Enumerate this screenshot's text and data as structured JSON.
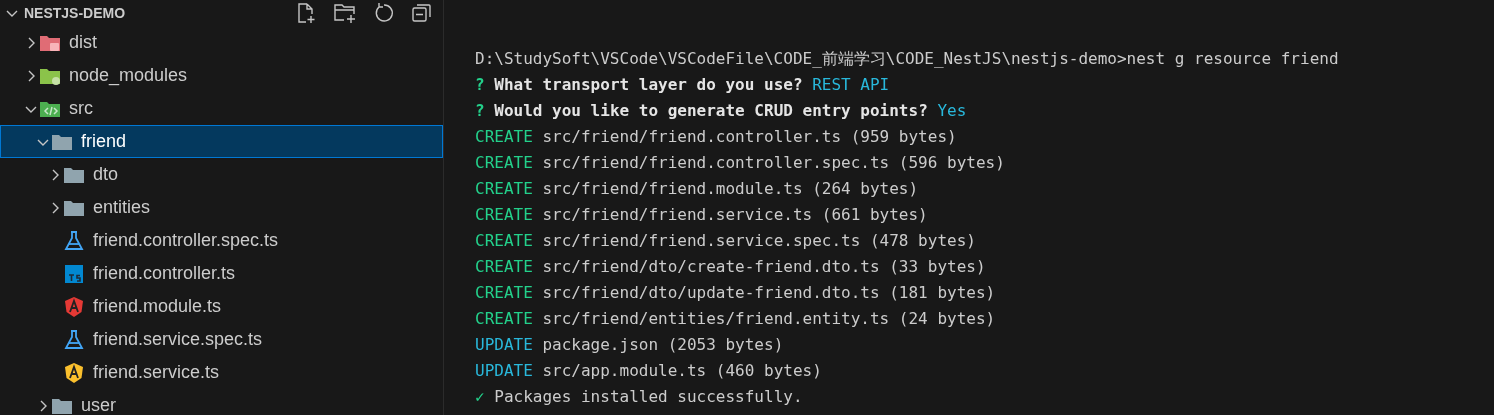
{
  "explorer": {
    "title": "NESTJS-DEMO",
    "expanded": true,
    "tree": [
      {
        "label": "dist",
        "kind": "dist",
        "expanded": false,
        "selected": false
      },
      {
        "label": "node_modules",
        "kind": "modules",
        "expanded": false,
        "selected": false
      },
      {
        "label": "src",
        "kind": "source",
        "expanded": true,
        "selected": false,
        "children": [
          {
            "label": "friend",
            "kind": "folder",
            "expanded": true,
            "selected": true,
            "children": [
              {
                "label": "dto",
                "kind": "folder",
                "expanded": false,
                "selected": false
              },
              {
                "label": "entities",
                "kind": "folder",
                "expanded": false,
                "selected": false
              },
              {
                "label": "friend.controller.spec.ts",
                "kind": "spec",
                "selected": false
              },
              {
                "label": "friend.controller.ts",
                "kind": "typescript",
                "selected": false
              },
              {
                "label": "friend.module.ts",
                "kind": "module",
                "selected": false
              },
              {
                "label": "friend.service.spec.ts",
                "kind": "spec",
                "selected": false
              },
              {
                "label": "friend.service.ts",
                "kind": "service",
                "selected": false
              }
            ]
          },
          {
            "label": "user",
            "kind": "folder",
            "expanded": false,
            "selected": false
          }
        ]
      }
    ]
  },
  "terminal": {
    "lines": [
      {
        "kind": "command",
        "text": "D:\\StudySoft\\VSCode\\VSCodeFile\\CODE_前端学习\\CODE_NestJS\\nestjs-demo>nest g resource friend"
      },
      {
        "kind": "prompt",
        "mark": "?",
        "question": "What transport layer do you use?",
        "answer": "REST API"
      },
      {
        "kind": "prompt",
        "mark": "?",
        "question": "Would you like to generate CRUD entry points?",
        "answer": "Yes"
      },
      {
        "kind": "action",
        "action": "CREATE",
        "color": "#23d18b",
        "text": "src/friend/friend.controller.ts (959 bytes)"
      },
      {
        "kind": "action",
        "action": "CREATE",
        "color": "#23d18b",
        "text": "src/friend/friend.controller.spec.ts (596 bytes)"
      },
      {
        "kind": "action",
        "action": "CREATE",
        "color": "#23d18b",
        "text": "src/friend/friend.module.ts (264 bytes)"
      },
      {
        "kind": "action",
        "action": "CREATE",
        "color": "#23d18b",
        "text": "src/friend/friend.service.ts (661 bytes)"
      },
      {
        "kind": "action",
        "action": "CREATE",
        "color": "#23d18b",
        "text": "src/friend/friend.service.spec.ts (478 bytes)"
      },
      {
        "kind": "action",
        "action": "CREATE",
        "color": "#23d18b",
        "text": "src/friend/dto/create-friend.dto.ts (33 bytes)"
      },
      {
        "kind": "action",
        "action": "CREATE",
        "color": "#23d18b",
        "text": "src/friend/dto/update-friend.dto.ts (181 bytes)"
      },
      {
        "kind": "action",
        "action": "CREATE",
        "color": "#23d18b",
        "text": "src/friend/entities/friend.entity.ts (24 bytes)"
      },
      {
        "kind": "action",
        "action": "UPDATE",
        "color": "#29b8db",
        "text": "package.json (2053 bytes)"
      },
      {
        "kind": "action",
        "action": "UPDATE",
        "color": "#29b8db",
        "text": "src/app.module.ts (460 bytes)"
      },
      {
        "kind": "success",
        "mark": "✓",
        "text": "Packages installed successfully."
      }
    ]
  }
}
